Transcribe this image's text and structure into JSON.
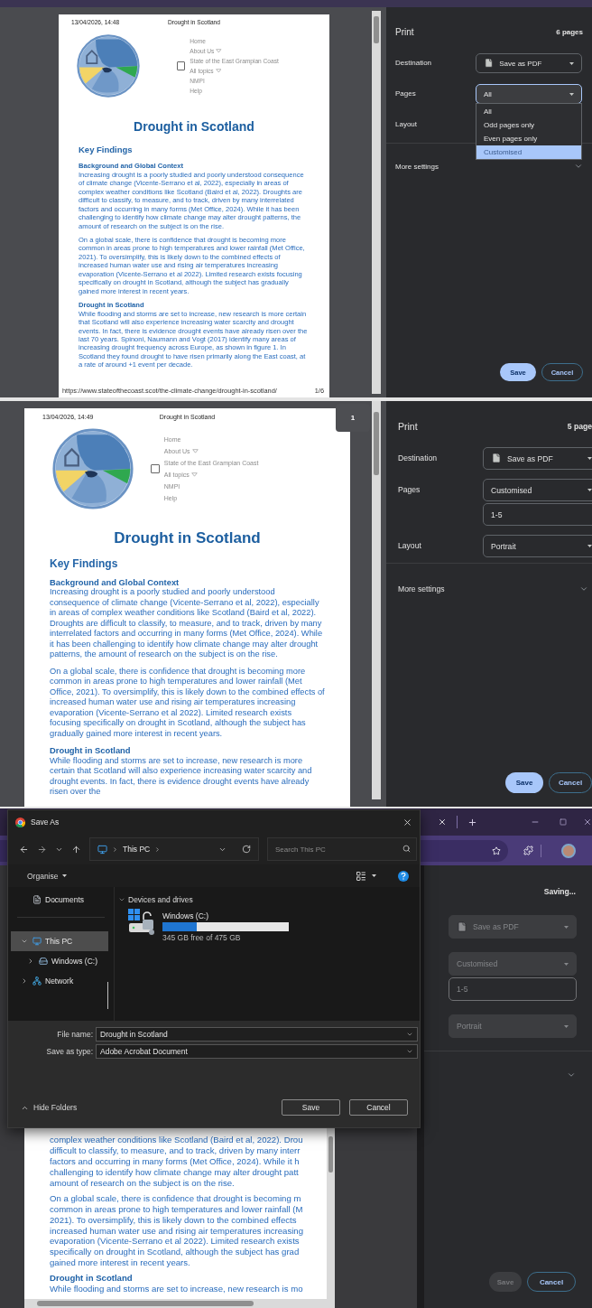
{
  "screen_1": {
    "document": {
      "header_date": "13/04/2026, 14:48",
      "header_title": "Drought in Scotland",
      "menu_checkbox": {
        "checked": false
      },
      "nav": [
        {
          "label": "Home",
          "has_caret": false
        },
        {
          "label": "About Us",
          "has_caret": true
        },
        {
          "label": "State of the East Grampian Coast",
          "has_caret": false
        },
        {
          "label": "All topics",
          "has_caret": true
        },
        {
          "label": "NMPI",
          "has_caret": false
        },
        {
          "label": "Help",
          "has_caret": false
        }
      ],
      "title": "Drought in Scotland",
      "blocks": [
        {
          "kind": "heading",
          "text": "Key Findings"
        },
        {
          "kind": "subheading",
          "text": "Background and Global Context"
        },
        {
          "kind": "paragraph",
          "text": "Increasing drought is a poorly studied and poorly understood consequence of climate change (Vicente-Serrano et al, 2022), especially in areas of complex weather conditions like Scotland (Baird et al, 2022). Droughts are difficult to classify, to measure, and to track, driven by many interrelated factors and occurring in many forms (Met Office, 2024). While it has been challenging to identify how climate change may alter drought patterns, the amount of research on the subject is on the rise."
        },
        {
          "kind": "paragraph",
          "text": "On a global scale, there is confidence that drought is becoming more common in areas prone to high temperatures and lower rainfall (Met Office, 2021). To oversimplify, this is likely down to the combined effects of increased human water use and rising air temperatures increasing evaporation (Vicente-Serrano et al 2022). Limited research exists focusing specifically on drought in Scotland, although the subject has gradually gained more interest in recent years."
        },
        {
          "kind": "subheading",
          "text": "Drought in Scotland"
        },
        {
          "kind": "paragraph",
          "text": "While flooding and storms are set to increase, new research is more certain that Scotland will also experience increasing water scarcity and drought events. In fact, there is evidence drought events have already risen over the last 70 years. Spinoni, Naumann and Vogt (2017) identify many areas of increasing drought frequency across Europe, as shown in figure 1. In Scotland they found drought to have risen primarily along the East coast, at a rate of around +1 event per decade."
        }
      ],
      "footer_url": "https://www.stateofthecoast.scot/the-climate-change/drought-in-scotland/",
      "footer_page": "1/6"
    },
    "settings": {
      "title": "Print",
      "page_count": "6 pages",
      "rows": [
        {
          "label": "Destination",
          "controls": [
            {
              "kind": "destination",
              "value": "Save as PDF",
              "disabled": false
            }
          ]
        },
        {
          "label": "Pages",
          "controls": [
            {
              "kind": "select",
              "value": "All",
              "disabled": false,
              "open": true,
              "options": [
                {
                  "label": "All",
                  "highlighted": false
                },
                {
                  "label": "Odd pages only",
                  "highlighted": false
                },
                {
                  "label": "Even pages only",
                  "highlighted": false
                },
                {
                  "label": "Customised",
                  "highlighted": true
                }
              ]
            }
          ]
        },
        {
          "label": "Layout"
        }
      ],
      "more_settings": {
        "label": "More settings",
        "expanded": false
      },
      "buttons": [
        {
          "label": "Save",
          "kind": "primary",
          "disabled": false
        },
        {
          "label": "Cancel",
          "kind": "secondary",
          "disabled": false
        }
      ]
    }
  },
  "screen_2": {
    "page_badge": "1",
    "document": {
      "header_date": "13/04/2026, 14:49",
      "header_title": "Drought in Scotland",
      "menu_checkbox": {
        "checked": false
      },
      "nav": [
        {
          "label": "Home",
          "has_caret": false
        },
        {
          "label": "About Us",
          "has_caret": true
        },
        {
          "label": "State of the East Grampian Coast",
          "has_caret": false
        },
        {
          "label": "All topics",
          "has_caret": true
        },
        {
          "label": "NMPI",
          "has_caret": false
        },
        {
          "label": "Help",
          "has_caret": false
        }
      ],
      "title": "Drought in Scotland",
      "blocks": [
        {
          "kind": "heading",
          "text": "Key Findings"
        },
        {
          "kind": "subheading",
          "text": "Background and Global Context"
        },
        {
          "kind": "paragraph",
          "text": "Increasing drought is a poorly studied and poorly understood consequence of climate change (Vicente-Serrano et al, 2022), especially in areas of complex weather conditions like Scotland (Baird et al, 2022). Droughts are difficult to classify, to measure, and to track, driven by many interrelated factors and occurring in many forms (Met Office, 2024). While it has been challenging to identify how climate change may alter drought patterns, the amount of research on the subject is on the rise."
        },
        {
          "kind": "paragraph",
          "text": "On a global scale, there is confidence that drought is becoming more common in areas prone to high temperatures and lower rainfall (Met Office, 2021). To oversimplify, this is likely down to the combined effects of increased human water use and rising air temperatures increasing evaporation (Vicente-Serrano et al 2022). Limited research exists focusing specifically on drought in Scotland, although the subject has gradually gained more interest in recent years."
        },
        {
          "kind": "subheading",
          "text": "Drought in Scotland"
        },
        {
          "kind": "paragraph",
          "text": "While flooding and storms are set to increase, new research is more certain that Scotland will also experience increasing water scarcity and drought events. In fact, there is evidence drought events have already risen over the"
        }
      ]
    },
    "settings": {
      "title": "Print",
      "page_count": "5 page",
      "rows": [
        {
          "label": "Destination",
          "controls": [
            {
              "kind": "destination",
              "value": "Save as PDF",
              "disabled": false
            }
          ]
        },
        {
          "label": "Pages",
          "controls": [
            {
              "kind": "select",
              "value": "Customised",
              "disabled": false
            },
            {
              "kind": "input",
              "value": "1-5",
              "disabled": false
            }
          ]
        },
        {
          "label": "Layout",
          "controls": [
            {
              "kind": "select",
              "value": "Portrait",
              "disabled": false
            }
          ]
        }
      ],
      "more_settings": {
        "label": "More settings",
        "expanded": false
      },
      "buttons": [
        {
          "label": "Save",
          "kind": "primary",
          "disabled": false
        },
        {
          "label": "Cancel",
          "kind": "secondary",
          "disabled": false
        }
      ]
    }
  },
  "screen_3": {
    "document": {
      "blocks": [
        {
          "kind": "paragraph",
          "lines": [
            "complex weather conditions like Scotland (Baird et al, 2022). Drou",
            "difficult to classify, to measure, and to track, driven by many interr",
            "factors and occurring in many forms (Met Office, 2024). While it h",
            "challenging to identify how climate change may alter drought patt",
            "amount of research on the subject is on the rise."
          ]
        },
        {
          "kind": "paragraph",
          "lines": [
            "On a global scale, there is confidence that drought is becoming m",
            "common in areas prone to high temperatures and lower rainfall (M",
            "2021). To oversimplify, this is likely down to the combined effects",
            "increased human water use and rising air temperatures increasing",
            "evaporation (Vicente-Serrano et al 2022). Limited research exists",
            "specifically on drought in Scotland, although the subject has grad",
            "gained more interest in recent years."
          ]
        },
        {
          "kind": "subheading",
          "text": "Drought in Scotland"
        },
        {
          "kind": "paragraph",
          "lines": [
            "While flooding and storms are set to increase, new research is mo"
          ]
        }
      ]
    },
    "settings": {
      "status": "Saving...",
      "rows": [
        {
          "controls": [
            {
              "kind": "destination",
              "value": "Save as PDF",
              "disabled": true
            }
          ]
        },
        {
          "controls": [
            {
              "kind": "select",
              "value": "Customised",
              "disabled": true
            },
            {
              "kind": "input",
              "value": "1-5",
              "disabled": true
            }
          ]
        },
        {
          "controls": [
            {
              "kind": "select",
              "value": "Portrait",
              "disabled": true
            }
          ]
        }
      ],
      "more_settings": {
        "expanded": false
      },
      "buttons": [
        {
          "label": "Save",
          "kind": "primary",
          "disabled": true
        },
        {
          "label": "Cancel",
          "kind": "secondary",
          "disabled": false
        }
      ]
    },
    "save_as_dialog": {
      "title": "Save As",
      "breadcrumb": "This PC",
      "search_placeholder": "Search This PC",
      "organise": "Organise",
      "tree": [
        {
          "label": "Documents",
          "kind": "documents",
          "selected": false
        },
        {
          "label": "This PC",
          "kind": "pc",
          "selected": true,
          "expanded": true,
          "children": [
            {
              "label": "Windows (C:)",
              "kind": "drive",
              "selected": false,
              "expanded": false
            }
          ]
        },
        {
          "label": "Network",
          "kind": "network",
          "selected": false,
          "expanded": false
        }
      ],
      "group": {
        "label": "Devices and drives",
        "expanded": true
      },
      "drives": [
        {
          "label": "Windows (C:)",
          "level": 0.27,
          "caption": "345 GB free of 475 GB"
        }
      ],
      "fields": [
        {
          "label": "File name:",
          "value": "Drought in Scotland"
        },
        {
          "label": "Save as type:",
          "value": "Adobe Acrobat Document"
        }
      ],
      "hide_folders": "Hide Folders",
      "buttons": [
        {
          "label": "Save"
        },
        {
          "label": "Cancel"
        }
      ]
    }
  }
}
